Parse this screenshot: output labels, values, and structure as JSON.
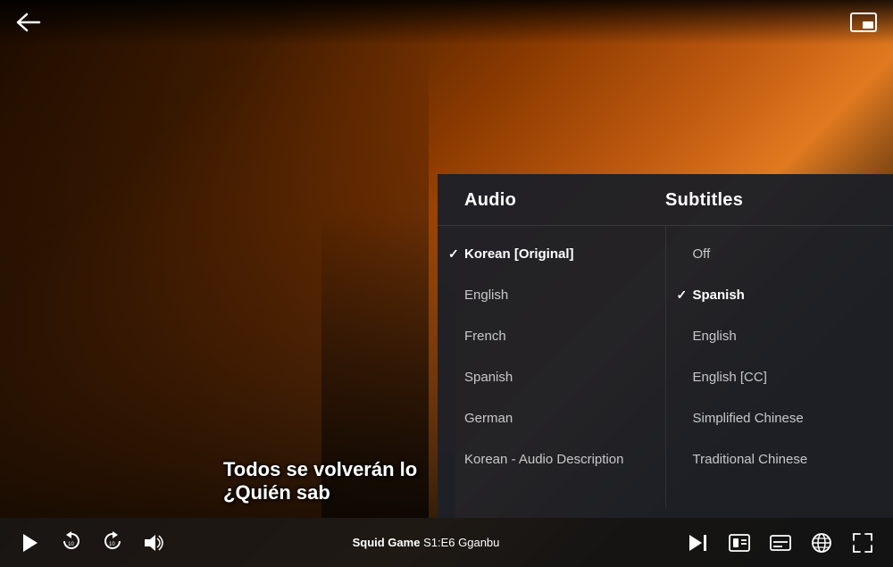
{
  "topBar": {
    "backLabel": "←",
    "pipLabel": "⧉"
  },
  "videoScene": {
    "subtitle1": "Todos se volverán lo",
    "subtitle2": "¿Quién sab"
  },
  "panel": {
    "audioHeader": "Audio",
    "subtitlesHeader": "Subtitles",
    "audioItems": [
      {
        "id": "korean-original",
        "label": "Korean [Original]",
        "active": true
      },
      {
        "id": "english",
        "label": "English",
        "active": false
      },
      {
        "id": "french",
        "label": "French",
        "active": false
      },
      {
        "id": "spanish",
        "label": "Spanish",
        "active": false
      },
      {
        "id": "german",
        "label": "German",
        "active": false
      },
      {
        "id": "korean-ad",
        "label": "Korean - Audio Description",
        "active": false
      }
    ],
    "subtitleItems": [
      {
        "id": "off",
        "label": "Off",
        "active": false
      },
      {
        "id": "spanish",
        "label": "Spanish",
        "active": true
      },
      {
        "id": "english",
        "label": "English",
        "active": false
      },
      {
        "id": "english-cc",
        "label": "English [CC]",
        "active": false
      },
      {
        "id": "simplified-chinese",
        "label": "Simplified Chinese",
        "active": false
      },
      {
        "id": "traditional-chinese",
        "label": "Traditional Chinese",
        "active": false
      }
    ]
  },
  "bottomBar": {
    "showInfo": "Squid Game",
    "episodeInfo": "S1:E6",
    "episodeTitle": "Gganbu",
    "playIcon": "▶",
    "replayIcon": "↺₁₀",
    "forwardIcon": "↻₁₀",
    "volumeIcon": "🔊",
    "nextIcon": "⏭",
    "subtitlesIcon": "⊟",
    "audioIcon": "♪",
    "infoIcon": "ℹ",
    "fullscreenIcon": "⛶"
  },
  "colors": {
    "panelBg": "#1e2026",
    "activeColor": "#ffffff",
    "inactiveColor": "rgba(255,255,255,0.75)",
    "headerColor": "#ffffff"
  }
}
